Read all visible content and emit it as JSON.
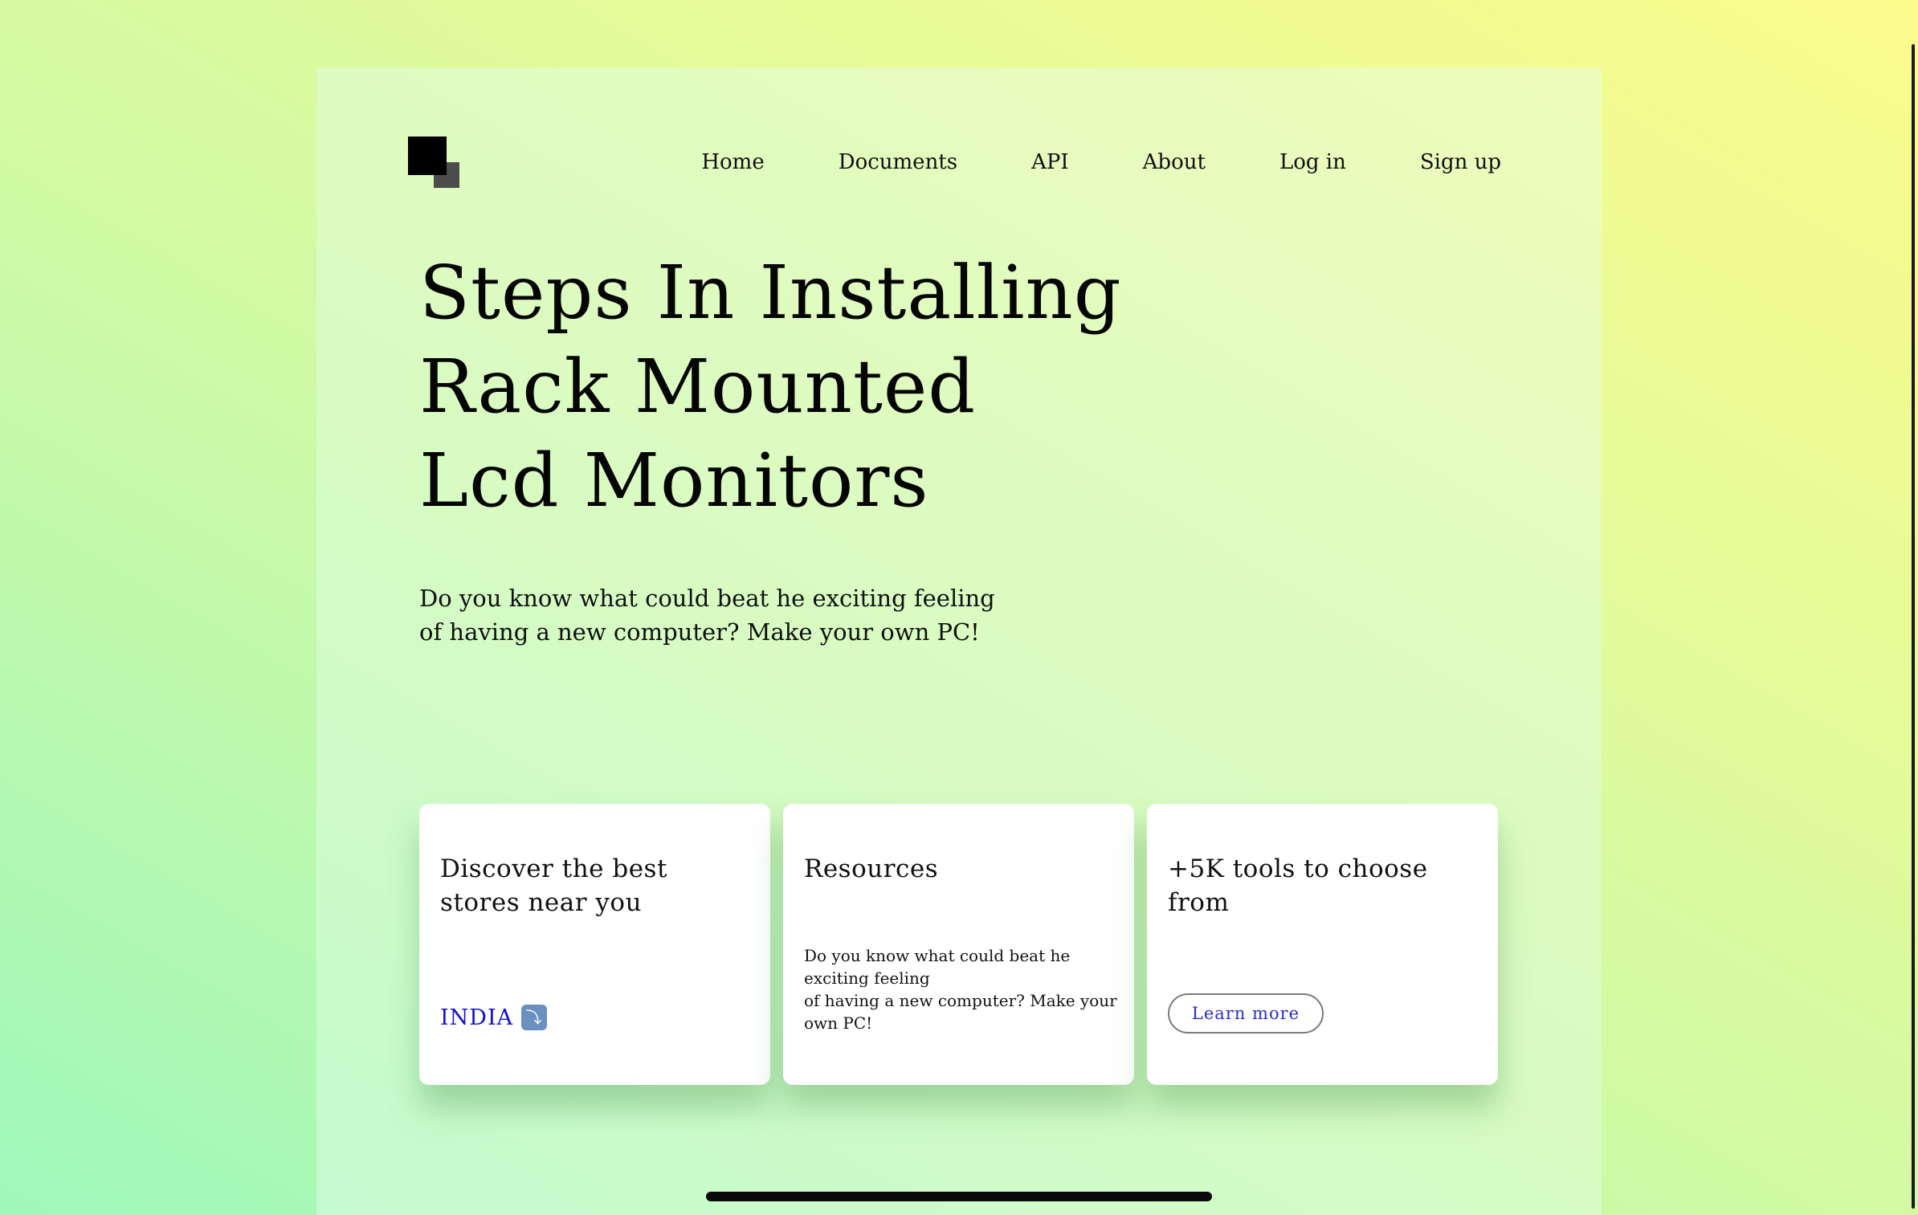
{
  "nav": {
    "items": [
      {
        "label": "Home"
      },
      {
        "label": "Documents"
      },
      {
        "label": "API"
      },
      {
        "label": "About"
      },
      {
        "label": "Log in"
      },
      {
        "label": "Sign up"
      }
    ]
  },
  "hero": {
    "title": "Steps In Installing Rack Mounted Lcd Monitors",
    "subtitle_line1": "Do you know what could beat he exciting feeling",
    "subtitle_line2": "of having a new computer? Make your own PC!"
  },
  "cards": [
    {
      "title": "Discover the best stores near you",
      "link_label": "INDIA",
      "link_icon": "⤵"
    },
    {
      "title": "Resources",
      "body_line1": "Do you know what could beat he",
      "body_line2": "exciting feeling",
      "body_line3": "of having a new computer? Make your",
      "body_line4": "own PC!"
    },
    {
      "title": "+5K tools to choose from",
      "button_label": "Learn more"
    }
  ],
  "colors": {
    "accent_link": "#1010d8",
    "button_text": "#2a2ad0"
  }
}
